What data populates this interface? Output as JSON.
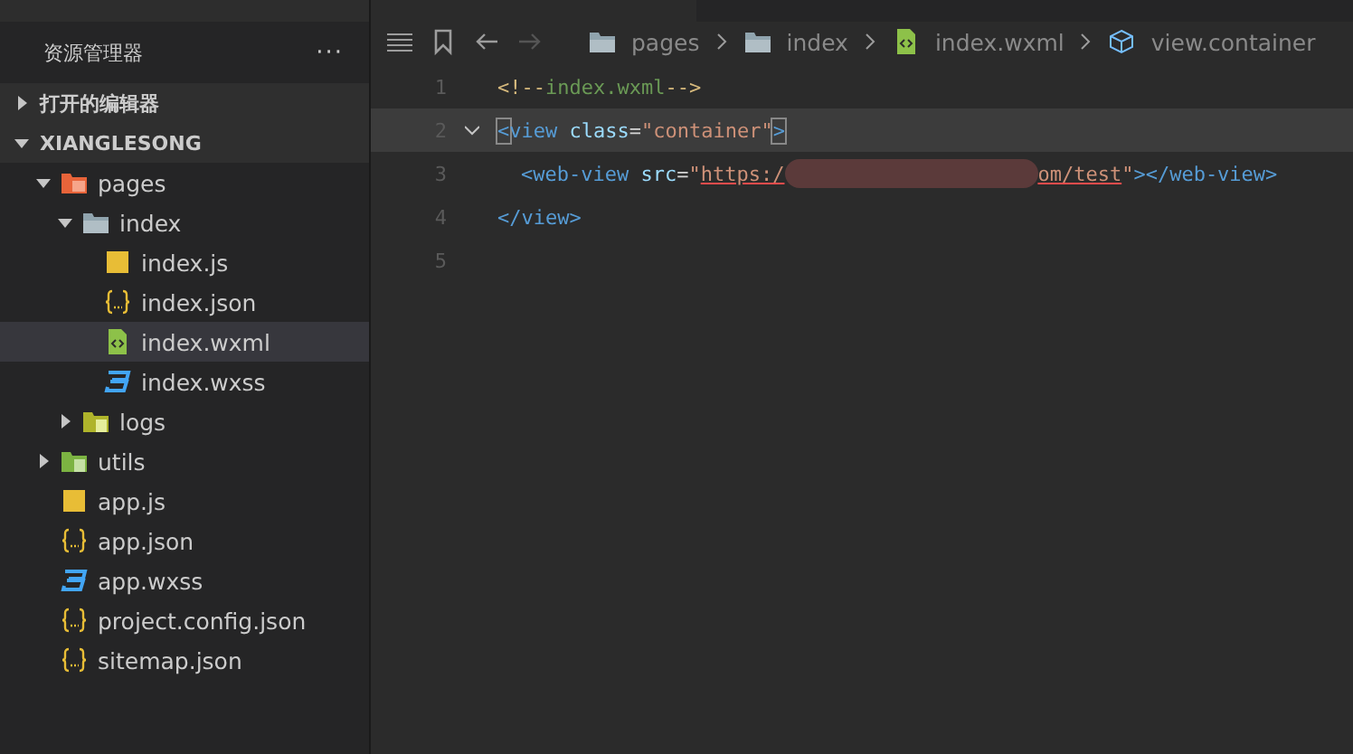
{
  "sidebar": {
    "title": "资源管理器",
    "more": "···",
    "sections": [
      {
        "label": "打开的编辑器",
        "expanded": false
      },
      {
        "label": "XIANGLESONG",
        "expanded": true
      }
    ],
    "tree": [
      {
        "name": "pages",
        "kind": "folder-pages",
        "expanded": true,
        "selected": false,
        "children": [
          {
            "name": "index",
            "kind": "folder",
            "expanded": true,
            "selected": false,
            "children": [
              {
                "name": "index.js",
                "kind": "js",
                "selected": false
              },
              {
                "name": "index.json",
                "kind": "json",
                "selected": false
              },
              {
                "name": "index.wxml",
                "kind": "wxml",
                "selected": true
              },
              {
                "name": "index.wxss",
                "kind": "wxss",
                "selected": false
              }
            ]
          },
          {
            "name": "logs",
            "kind": "folder-logs",
            "expanded": false,
            "selected": false
          }
        ]
      },
      {
        "name": "utils",
        "kind": "folder-utils",
        "expanded": false,
        "selected": false
      },
      {
        "name": "app.js",
        "kind": "js",
        "selected": false
      },
      {
        "name": "app.json",
        "kind": "json",
        "selected": false
      },
      {
        "name": "app.wxss",
        "kind": "wxss",
        "selected": false
      },
      {
        "name": "project.config.json",
        "kind": "json",
        "selected": false
      },
      {
        "name": "sitemap.json",
        "kind": "json",
        "selected": false
      }
    ]
  },
  "breadcrumb": [
    {
      "label": "pages",
      "kind": "folder"
    },
    {
      "label": "index",
      "kind": "folder"
    },
    {
      "label": "index.wxml",
      "kind": "wxml"
    },
    {
      "label": "view.container",
      "kind": "element"
    }
  ],
  "editor": {
    "lines": [
      {
        "number": "1",
        "current": false,
        "fold": false,
        "indented": false,
        "tokens": [
          {
            "kind": "comment-mark",
            "text": "<!--"
          },
          {
            "kind": "comment",
            "text": "index.wxml"
          },
          {
            "kind": "comment-mark",
            "text": "-->"
          }
        ]
      },
      {
        "number": "2",
        "current": true,
        "fold": true,
        "indented": false,
        "tokens": [
          {
            "kind": "match",
            "text": "<"
          },
          {
            "kind": "tag",
            "text": "view"
          },
          {
            "kind": "attr",
            "text": " class"
          },
          {
            "kind": "plain",
            "text": "="
          },
          {
            "kind": "string",
            "text": "\"container\""
          },
          {
            "kind": "match",
            "text": ">"
          }
        ]
      },
      {
        "number": "3",
        "current": false,
        "fold": false,
        "indented": true,
        "tokens": [
          {
            "kind": "tag",
            "text": "<web-view"
          },
          {
            "kind": "attr",
            "text": " src"
          },
          {
            "kind": "plain",
            "text": "="
          },
          {
            "kind": "string",
            "text": "\""
          },
          {
            "kind": "link",
            "text": "https:/"
          },
          {
            "kind": "redacted"
          },
          {
            "kind": "link",
            "text": "om/test"
          },
          {
            "kind": "string",
            "text": "\""
          },
          {
            "kind": "tag",
            "text": "></web-view>"
          }
        ]
      },
      {
        "number": "4",
        "current": false,
        "fold": false,
        "indented": false,
        "tokens": [
          {
            "kind": "tag",
            "text": "</view>"
          }
        ]
      },
      {
        "number": "5",
        "current": false,
        "fold": false
      }
    ]
  }
}
